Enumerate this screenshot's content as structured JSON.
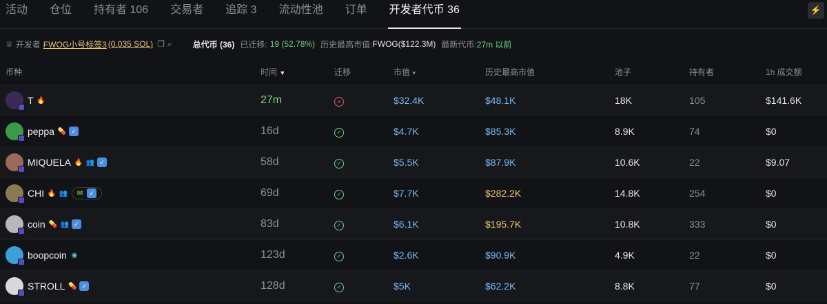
{
  "tabs": [
    "活动",
    "仓位",
    "持有者 106",
    "交易者",
    "追踪 3",
    "流动性池",
    "订单",
    "开发者代币 36"
  ],
  "corner_icon": "bolt-icon",
  "dev": {
    "label": "开发者",
    "name": "FWOG小号标签3",
    "balance": "(0.035 SOL)",
    "total": "总代币 (36)",
    "migrated_label": "已迁移:",
    "migrated_value": "19 (52.78%)",
    "ath_label": "历史最高市值:",
    "ath_value": "FWOG($122.3M)",
    "latest_label": "最新代币:",
    "latest_value": "27m 以前"
  },
  "columns": [
    "币种",
    "时间",
    "迁移",
    "市值",
    "历史最高市值",
    "池子",
    "持有者",
    "1h 成交额"
  ],
  "colors": {
    "blue": "#78b8f5",
    "gold": "#f0c36a",
    "green": "#6fd38a",
    "red": "#f0556a"
  },
  "rows": [
    {
      "name": "T",
      "avatar": "#3b2a57",
      "badges": [
        "fire"
      ],
      "time": "27m",
      "migrated": false,
      "mcap": "$32.4K",
      "ath": "$48.1K",
      "ath_gold": false,
      "pool": "18K",
      "holders": "105",
      "vol": "$141.6K",
      "vol_blue": true
    },
    {
      "name": "peppa",
      "avatar": "#3a9a4a",
      "badges": [
        "pill",
        "tw"
      ],
      "time": "16d",
      "migrated": true,
      "mcap": "$4.7K",
      "ath": "$85.3K",
      "ath_gold": false,
      "pool": "8.9K",
      "holders": "74",
      "vol": "$0",
      "vol_blue": false
    },
    {
      "name": "MIQUELA",
      "avatar": "#9a6a5a",
      "badges": [
        "fire",
        "duo",
        "tw"
      ],
      "time": "58d",
      "migrated": true,
      "mcap": "$5.5K",
      "ath": "$87.9K",
      "ath_gold": false,
      "pool": "10.6K",
      "holders": "22",
      "vol": "$9.07",
      "vol_blue": false
    },
    {
      "name": "CHI",
      "avatar": "#8a7a5a",
      "badges": [
        "fire",
        "duo",
        "group"
      ],
      "time": "69d",
      "migrated": true,
      "mcap": "$7.7K",
      "ath": "$282.2K",
      "ath_gold": true,
      "pool": "14.8K",
      "holders": "254",
      "vol": "$0",
      "vol_blue": false
    },
    {
      "name": "coin",
      "avatar": "#b8b8b8",
      "badges": [
        "pill",
        "duo",
        "tw"
      ],
      "time": "83d",
      "migrated": true,
      "mcap": "$6.1K",
      "ath": "$195.7K",
      "ath_gold": true,
      "pool": "10.8K",
      "holders": "333",
      "vol": "$0",
      "vol_blue": false
    },
    {
      "name": "boopcoin",
      "avatar": "#3aa0d8",
      "badges": [
        "boop"
      ],
      "time": "123d",
      "migrated": true,
      "mcap": "$2.6K",
      "ath": "$90.9K",
      "ath_gold": false,
      "pool": "4.9K",
      "holders": "22",
      "vol": "$0",
      "vol_blue": false
    },
    {
      "name": "STROLL",
      "avatar": "#d8d8d8",
      "badges": [
        "pill",
        "tw"
      ],
      "time": "128d",
      "migrated": true,
      "mcap": "$5K",
      "ath": "$62.2K",
      "ath_gold": false,
      "pool": "8.8K",
      "holders": "77",
      "vol": "$0",
      "vol_blue": false
    }
  ]
}
